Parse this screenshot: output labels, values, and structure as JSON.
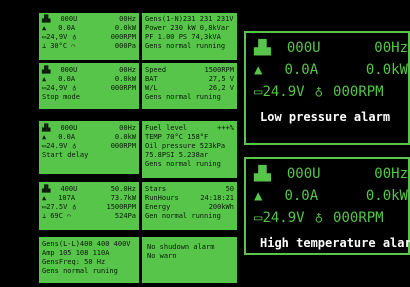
{
  "panels": [
    {
      "lines": [
        "000U",
        "00Hz",
        "0.0A",
        "0.0kW",
        "24,9V",
        "000RPM",
        "30°C",
        "000Pa"
      ]
    },
    {
      "lines": [
        "Gens(1-N)231 231 231V",
        "Power 230 kW  0,8kVar",
        "PF  1.00 PS  74,3kVA",
        "Gens normal running"
      ]
    },
    {
      "lines": [
        "000U",
        "00Hz",
        "0.0A",
        "0.0kW",
        "24,9V",
        "000RPM",
        "Stop mode"
      ]
    },
    {
      "lines": [
        "Speed",
        "1500RPM",
        "BAT",
        "27,5 V",
        "W/L",
        "26,2 V",
        "Gens normal runing"
      ]
    },
    {
      "lines": [
        "000U",
        "00Hz",
        "0.0A",
        "0.0kW",
        "24.9V",
        "000RPM",
        "Start delay"
      ]
    },
    {
      "lines": [
        "Fuel level",
        "+++%",
        "TEMP   70°C 158°F",
        "Oil pressure  523kPa",
        "75.8PSI   5.238ar",
        "Gens normal runing"
      ]
    },
    {
      "lines": [
        "400U",
        "50.0Hz",
        "107A",
        "73.7kW",
        "27.5V",
        "1500RPM",
        "69C",
        "524Pa"
      ]
    },
    {
      "lines": [
        "Stars",
        "50",
        "RunHours",
        "24:18:21",
        "Energy",
        "200kWh",
        "Gen normal running"
      ]
    },
    {
      "lines": [
        "Gens(L-L)400 400 400V",
        "Amp  105  108  110A",
        "GensFreq:   50 Hz",
        "Gens normal runing"
      ]
    },
    {
      "lines": [
        "No shudown alarm",
        "No warn"
      ]
    }
  ],
  "big1": {
    "volt": "000U",
    "freq": "00Hz",
    "amp": "0.0A",
    "power": "0.0kW",
    "bat": "24.9V",
    "rpm": "000RPM",
    "alarm": "Low pressure alarm"
  },
  "big2": {
    "volt": "000U",
    "freq": "00Hz",
    "amp": "0.0A",
    "power": "0.0kW",
    "bat": "24.9V",
    "rpm": "000RPM",
    "alarm": "High temperature alarm"
  },
  "colors": {
    "accent": "#57c44a",
    "background": "#000000"
  }
}
